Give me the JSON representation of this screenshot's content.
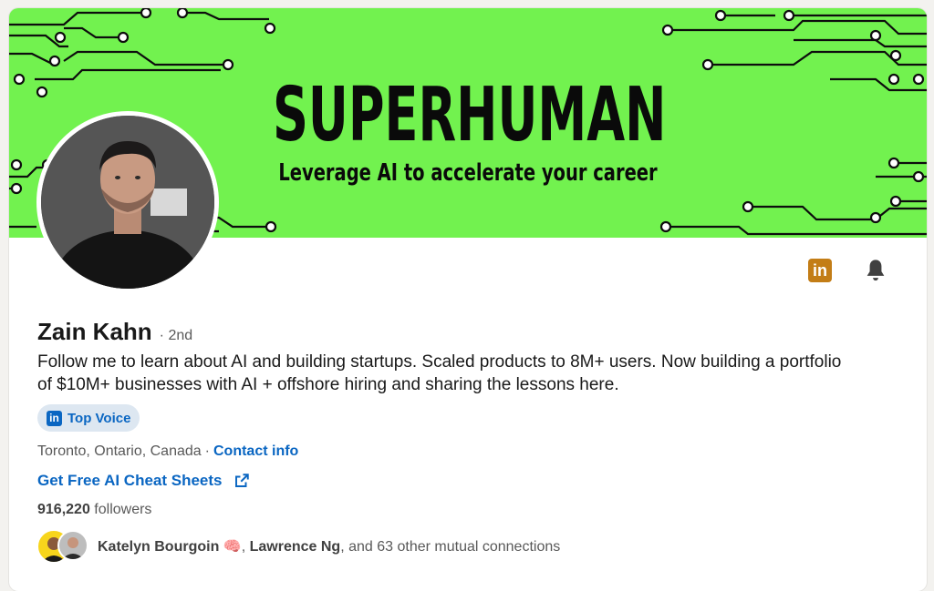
{
  "colors": {
    "banner_bg": "#72f24f",
    "link": "#0a66c2",
    "linkedin_gold": "#c37d16"
  },
  "banner": {
    "title": "SUPERHUMAN",
    "subtitle": "Leverage AI to accelerate your career"
  },
  "actions": {
    "linkedin_icon": "in",
    "notification_icon": "bell-icon"
  },
  "profile": {
    "name": "Zain Kahn",
    "degree": "· 2nd",
    "headline": "Follow me to learn about AI and building startups. Scaled products to 8M+ users. Now building a portfolio of $10M+ businesses with AI + offshore hiring and sharing the lessons here.",
    "badge_icon": "in",
    "badge_label": "Top Voice",
    "location": "Toronto, Ontario, Canada",
    "separator": "·",
    "contact_label": "Contact info",
    "website_label": "Get Free AI Cheat Sheets",
    "followers_count": "916,220",
    "followers_label": "followers"
  },
  "mutual": {
    "person1": "Katelyn Bourgoin",
    "person1_emoji": "🧠",
    "person2": "Lawrence Ng",
    "rest": ", and 63 other mutual connections"
  }
}
